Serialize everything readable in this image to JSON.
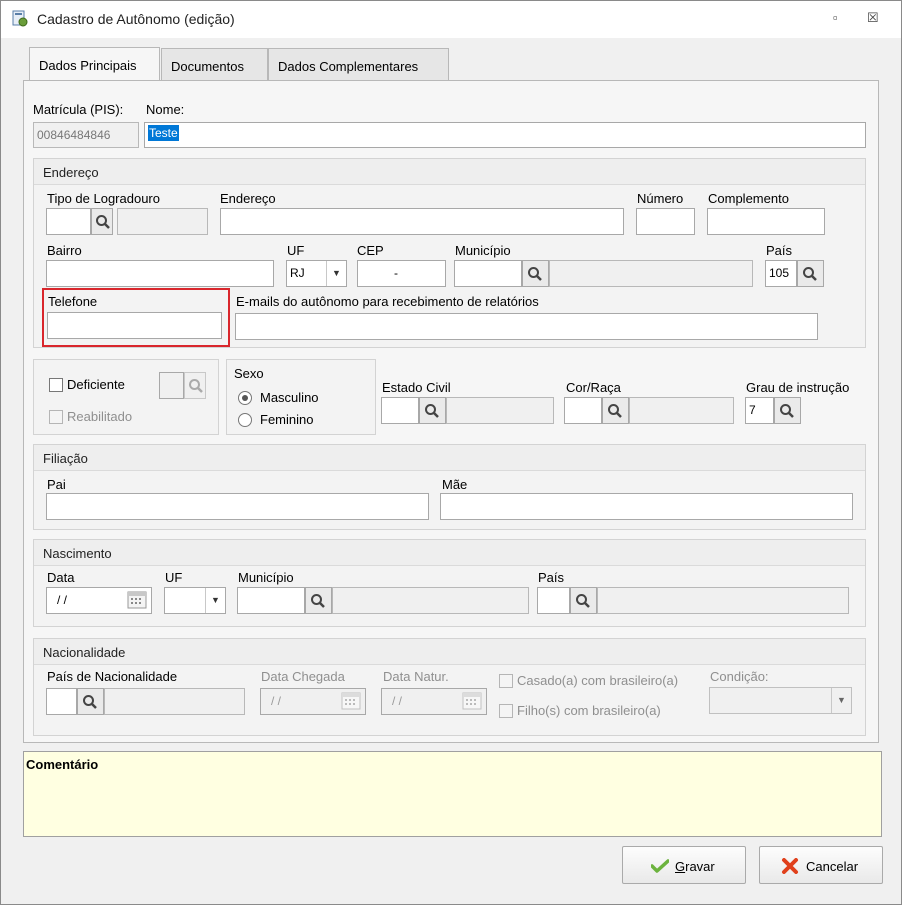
{
  "window": {
    "title": "Cadastro de Autônomo (edição)",
    "restore_glyph": "▫",
    "close_glyph": "☒"
  },
  "tabs": [
    "Dados Principais",
    "Documentos",
    "Dados Complementares"
  ],
  "matricula": {
    "label": "Matrícula (PIS):",
    "value": "00846484846"
  },
  "nome": {
    "label": "Nome:",
    "value": "Teste"
  },
  "endereco": {
    "group_title": "Endereço",
    "tipo_logradouro_label": "Tipo de Logradouro",
    "endereco_label": "Endereço",
    "numero_label": "Número",
    "complemento_label": "Complemento",
    "bairro_label": "Bairro",
    "uf_label": "UF",
    "uf_value": "RJ",
    "cep_label": "CEP",
    "cep_value": "-",
    "municipio_label": "Município",
    "pais_label": "País",
    "pais_value": "105",
    "telefone_label": "Telefone",
    "emails_label": "E-mails do autônomo para recebimento de relatórios"
  },
  "deficiente": {
    "label": "Deficiente",
    "reabilitado_label": "Reabilitado"
  },
  "sexo": {
    "title": "Sexo",
    "options": [
      "Masculino",
      "Feminino"
    ],
    "selected": "Masculino"
  },
  "estado_civil_label": "Estado Civil",
  "cor_raca_label": "Cor/Raça",
  "grau_instrucao": {
    "label": "Grau de instrução",
    "value": "7"
  },
  "filiacao": {
    "group_title": "Filiação",
    "pai_label": "Pai",
    "mae_label": "Mãe"
  },
  "nascimento": {
    "group_title": "Nascimento",
    "data_label": "Data",
    "data_value": "/ /",
    "uf_label": "UF",
    "municipio_label": "Município",
    "pais_label": "País"
  },
  "nacionalidade": {
    "group_title": "Nacionalidade",
    "pais_label": "País de Nacionalidade",
    "data_chegada_label": "Data Chegada",
    "data_chegada_value": "/ /",
    "data_natur_label": "Data Natur.",
    "data_natur_value": "/ /",
    "casado_label": "Casado(a) com brasileiro(a)",
    "filho_label": "Filho(s) com brasileiro(a)",
    "condicao_label": "Condição:"
  },
  "comentario_label": "Comentário",
  "buttons": {
    "gravar_prefix": "",
    "gravar_mnemonic": "G",
    "gravar_rest": "ravar",
    "cancelar": "Cancelar"
  },
  "colors": {
    "highlight_border": "#d9262c",
    "comment_bg": "#ffffe1",
    "selection_bg": "#0078d7"
  }
}
